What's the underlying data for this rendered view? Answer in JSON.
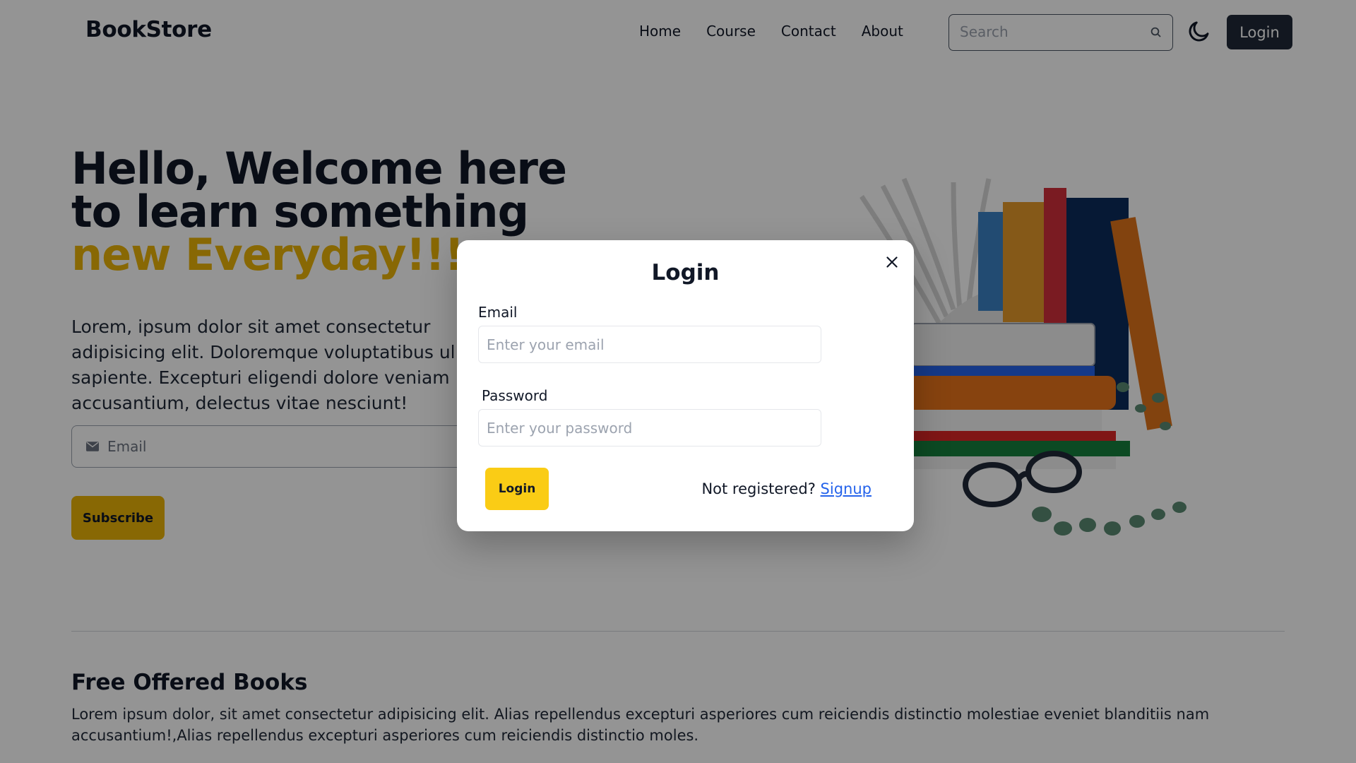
{
  "navbar": {
    "brand": "BookStore",
    "links": [
      "Home",
      "Course",
      "Contact",
      "About"
    ],
    "search_placeholder": "Search",
    "login_label": "Login"
  },
  "hero": {
    "title_part1": "Hello, Welcome here to learn something ",
    "title_accent": "new Everyday!!!",
    "description": "Lorem, ipsum dolor sit amet consectetur adipisicing elit. Doloremque voluptatibus ullam at sapiente. Excepturi eligendi dolore veniam accusantium, delectus vitae nesciunt!",
    "email_placeholder": "Email",
    "subscribe_label": "Subscribe"
  },
  "free_section": {
    "title": "Free Offered Books",
    "description": "Lorem ipsum dolor, sit amet consectetur adipisicing elit. Alias repellendus excepturi asperiores cum reiciendis distinctio molestiae eveniet blanditiis nam accusantium!,Alias repellendus excepturi asperiores cum reiciendis distinctio moles."
  },
  "modal": {
    "title": "Login",
    "email_label": "Email",
    "email_placeholder": "Enter your email",
    "password_label": "Password",
    "password_placeholder": "Enter your password",
    "login_label": "Login",
    "register_prompt": "Not registered?",
    "signup_label": "Signup"
  },
  "colors": {
    "accent": "#eab308",
    "dark": "#1f2937",
    "link": "#2563eb",
    "modal_button": "#facc15"
  }
}
